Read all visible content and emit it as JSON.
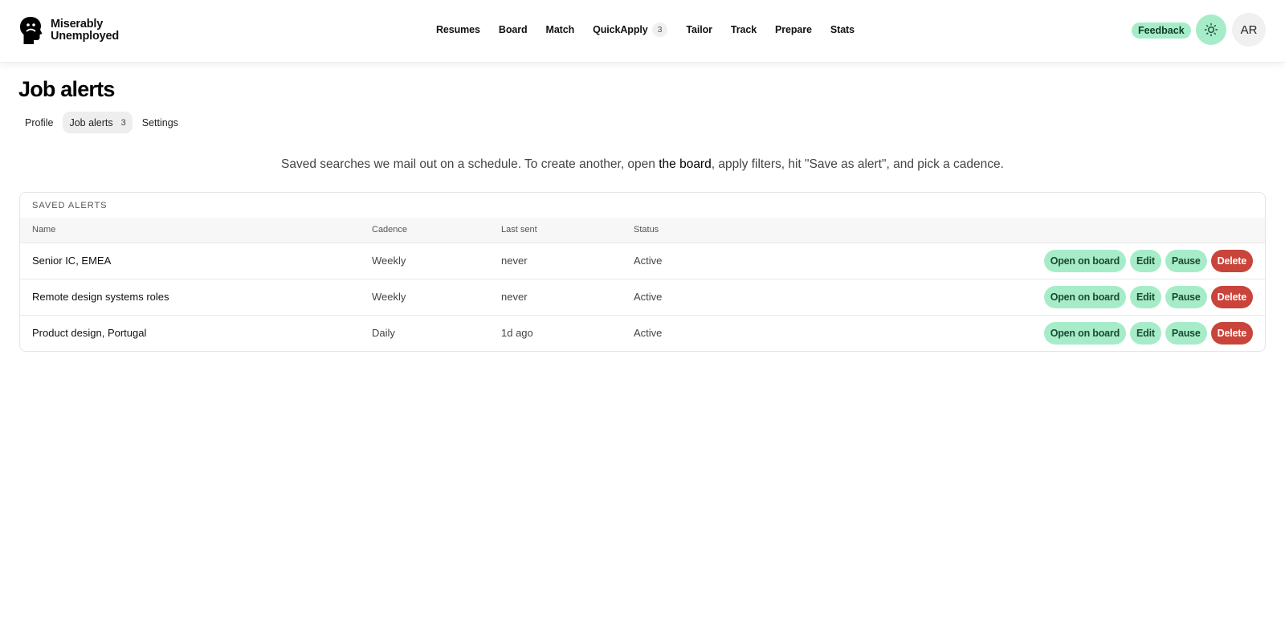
{
  "brand": {
    "line1": "Miserably",
    "line2": "Unemployed"
  },
  "nav": [
    {
      "label": "Resumes"
    },
    {
      "label": "Board"
    },
    {
      "label": "Match"
    },
    {
      "label": "QuickApply",
      "badge": "3"
    },
    {
      "label": "Tailor"
    },
    {
      "label": "Track"
    },
    {
      "label": "Prepare"
    },
    {
      "label": "Stats"
    }
  ],
  "header": {
    "feedback": "Feedback",
    "avatar_initials": "AR",
    "theme_icon": "sun-icon"
  },
  "page": {
    "title": "Job alerts",
    "tabs": [
      {
        "label": "Profile"
      },
      {
        "label": "Job alerts",
        "count": "3"
      },
      {
        "label": "Settings"
      }
    ],
    "intro_before": "Saved searches we mail out on a schedule. To create another, open ",
    "intro_link": "the board",
    "intro_after": ", apply filters, hit \"Save as alert\", and pick a cadence."
  },
  "alerts": {
    "section_title": "SAVED ALERTS",
    "columns": {
      "name": "Name",
      "cadence": "Cadence",
      "last_sent": "Last sent",
      "status": "Status"
    },
    "rows": [
      {
        "name": "Senior IC, EMEA",
        "cadence": "Weekly",
        "last_sent": "never",
        "status": "Active"
      },
      {
        "name": "Remote design systems roles",
        "cadence": "Weekly",
        "last_sent": "never",
        "status": "Active"
      },
      {
        "name": "Product design, Portugal",
        "cadence": "Daily",
        "last_sent": "1d ago",
        "status": "Active"
      }
    ],
    "actions": {
      "open": "Open on board",
      "edit": "Edit",
      "pause": "Pause",
      "delete": "Delete"
    }
  },
  "colors": {
    "accent_green": "#a7ecc9",
    "danger_red": "#c9443a"
  }
}
